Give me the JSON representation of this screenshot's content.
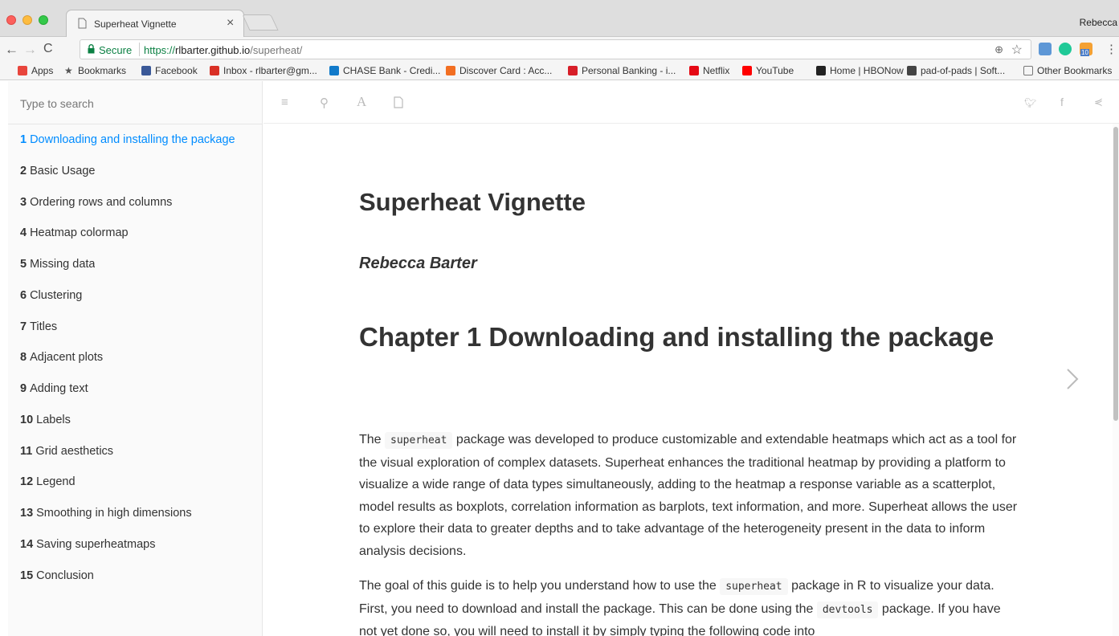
{
  "window": {
    "tab_title": "Superheat Vignette",
    "tab_close": "×",
    "profile": "Rebecca"
  },
  "toolbar": {
    "secure_label": "Secure",
    "url_scheme": "https://",
    "url_host": "rlbarter.github.io",
    "url_path": "/superheat/"
  },
  "bookmarks": [
    {
      "label": "Apps",
      "icon": "apps-grid-icon",
      "color": "#e8453c"
    },
    {
      "label": "Bookmarks",
      "icon": "star-icon",
      "color": "#555555"
    },
    {
      "label": "Facebook",
      "icon": "facebook-icon",
      "color": "#3b5998"
    },
    {
      "label": "Inbox - rlbarter@gm...",
      "icon": "gmail-icon",
      "color": "#d93025"
    },
    {
      "label": "CHASE Bank - Credi...",
      "icon": "chase-icon",
      "color": "#117aca"
    },
    {
      "label": "Discover Card : Acc...",
      "icon": "discover-icon",
      "color": "#f26e21"
    },
    {
      "label": "Personal Banking - i...",
      "icon": "bank-icon",
      "color": "#d71e28"
    },
    {
      "label": "Netflix",
      "icon": "netflix-icon",
      "color": "#e50914"
    },
    {
      "label": "YouTube",
      "icon": "youtube-icon",
      "color": "#ff0000"
    },
    {
      "label": "Home | HBONow",
      "icon": "hbo-icon",
      "color": "#222222"
    },
    {
      "label": "pad-of-pads | Soft...",
      "icon": "notepad-icon",
      "color": "#444444"
    },
    {
      "label": "Other Bookmarks",
      "icon": "folder-icon",
      "color": "#777777"
    }
  ],
  "sidebar": {
    "search_placeholder": "Type to search",
    "items": [
      {
        "num": "1",
        "label": "Downloading and installing the package"
      },
      {
        "num": "2",
        "label": "Basic Usage"
      },
      {
        "num": "3",
        "label": "Ordering rows and columns"
      },
      {
        "num": "4",
        "label": "Heatmap colormap"
      },
      {
        "num": "5",
        "label": "Missing data"
      },
      {
        "num": "6",
        "label": "Clustering"
      },
      {
        "num": "7",
        "label": "Titles"
      },
      {
        "num": "8",
        "label": "Adjacent plots"
      },
      {
        "num": "9",
        "label": "Adding text"
      },
      {
        "num": "10",
        "label": "Labels"
      },
      {
        "num": "11",
        "label": "Grid aesthetics"
      },
      {
        "num": "12",
        "label": "Legend"
      },
      {
        "num": "13",
        "label": "Smoothing in high dimensions"
      },
      {
        "num": "14",
        "label": "Saving superheatmaps"
      },
      {
        "num": "15",
        "label": "Conclusion"
      }
    ]
  },
  "document": {
    "title": "Superheat Vignette",
    "author": "Rebecca Barter",
    "chapter_heading": "Chapter 1 Downloading and installing the package",
    "p1": {
      "before": "The ",
      "code": "superheat",
      "after": " package was developed to produce customizable and extendable heatmaps which act as a tool for the visual exploration of complex datasets. Superheat enhances the traditional heatmap by providing a platform to visualize a wide range of data types simultaneously, adding to the heatmap a response variable as a scatterplot, model results as boxplots, correlation information as barplots, text information, and more. Superheat allows the user to explore their data to greater depths and to take advantage of the heterogeneity present in the data to inform analysis decisions."
    },
    "p2": {
      "before": "The goal of this guide is to help you understand how to use the ",
      "code1": "superheat",
      "middle": " package in R to visualize your data. First, you need to download and install the package. This can be done using the ",
      "code2": "devtools",
      "after": " package. If you have not yet done so, you will need to install it by simply typing the following code into"
    }
  },
  "colors": {
    "active_link": "#008cff",
    "secure_green": "#0b8043",
    "text": "#333333"
  }
}
